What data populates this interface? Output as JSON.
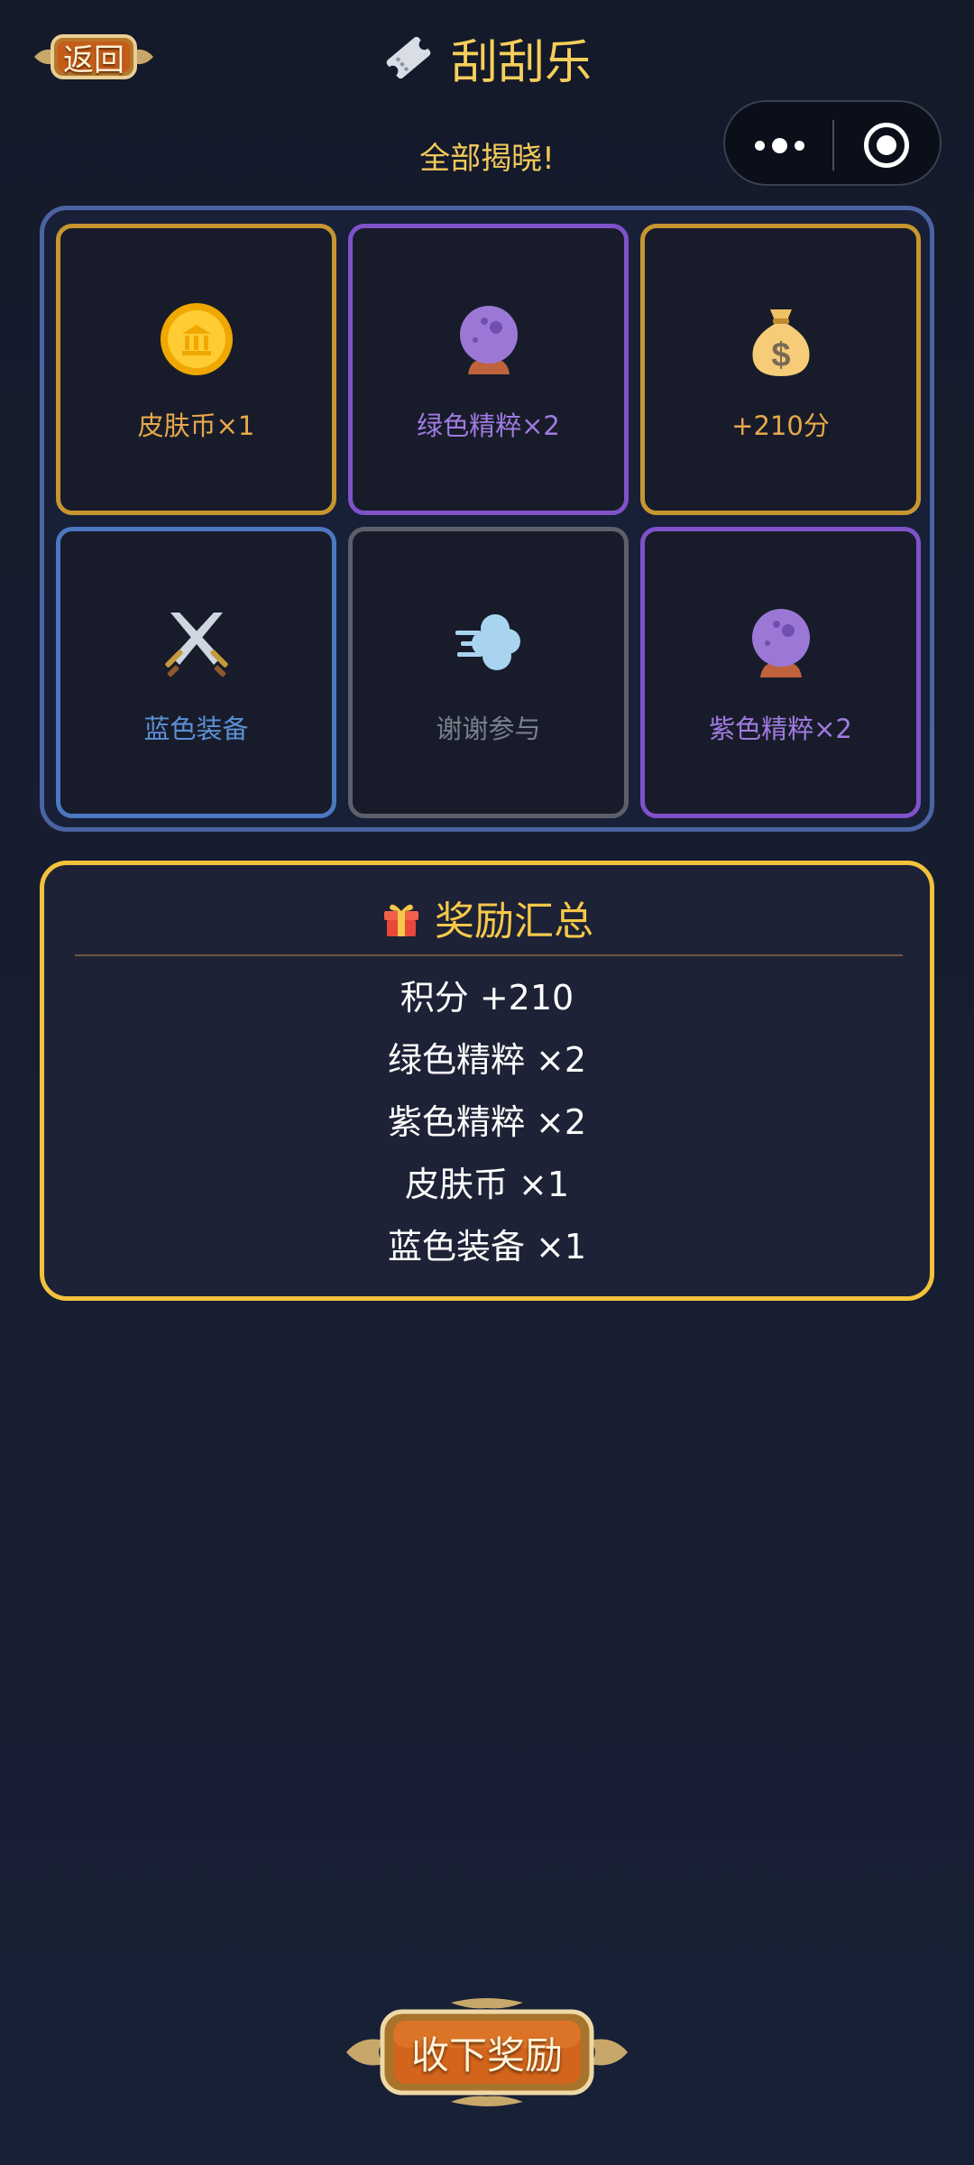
{
  "header": {
    "back_label": "返回",
    "title": "刮刮乐",
    "ticket_icon": "ticket-icon"
  },
  "status_text": "全部揭晓!",
  "capsule": {
    "more_icon": "more-dots-icon",
    "close_icon": "target-circle-icon"
  },
  "grid": {
    "cells": [
      {
        "label": "皮肤币×1",
        "icon": "coin-icon",
        "color": "#e8a84a",
        "border": "#c7962f"
      },
      {
        "label": "绿色精粹×2",
        "icon": "crystal-ball-icon",
        "color": "#a07ae0",
        "border": "#7f52c9"
      },
      {
        "label": "+210分",
        "icon": "money-bag-icon",
        "color": "#e8a84a",
        "border": "#c7962f"
      },
      {
        "label": "蓝色装备",
        "icon": "crossed-swords-icon",
        "color": "#5d8fd6",
        "border": "#4c78c0"
      },
      {
        "label": "谢谢参与",
        "icon": "wind-icon",
        "color": "#7a7f8c",
        "border": "#5d606a"
      },
      {
        "label": "紫色精粹×2",
        "icon": "crystal-ball-icon",
        "color": "#a07ae0",
        "border": "#7f52c9"
      }
    ]
  },
  "summary": {
    "title": "奖励汇总",
    "icon": "gift-icon",
    "lines": [
      "积分 +210",
      "绿色精粹 ×2",
      "紫色精粹 ×2",
      "皮肤币 ×1",
      "蓝色装备 ×1"
    ]
  },
  "claim_button_label": "收下奖励",
  "colors": {
    "accent": "#f6cf5a",
    "panel_border": "#4b63a3",
    "summary_border": "#f3c23c"
  }
}
